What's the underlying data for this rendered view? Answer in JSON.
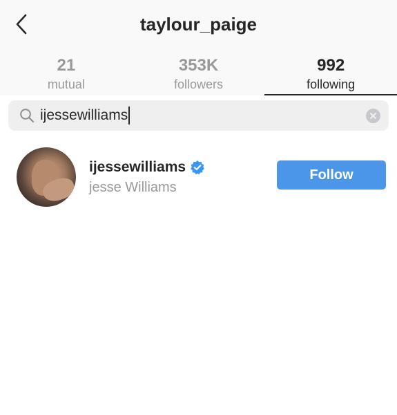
{
  "header": {
    "title": "taylour_paige",
    "back_icon": "chevron-left-icon"
  },
  "tabs": [
    {
      "count": "21",
      "label": "mutual",
      "active": false
    },
    {
      "count": "353K",
      "label": "followers",
      "active": false
    },
    {
      "count": "992",
      "label": "following",
      "active": true
    }
  ],
  "search": {
    "icon": "search-icon",
    "value": "ijessewilliams",
    "clear_icon": "clear-icon"
  },
  "results": [
    {
      "username": "ijessewilliams",
      "full_name": "jesse Williams",
      "verified": true,
      "follow_label": "Follow"
    }
  ],
  "colors": {
    "accent": "#4c96ea",
    "verified": "#3897f0",
    "muted_text": "#999999",
    "primary_text": "#262626"
  }
}
